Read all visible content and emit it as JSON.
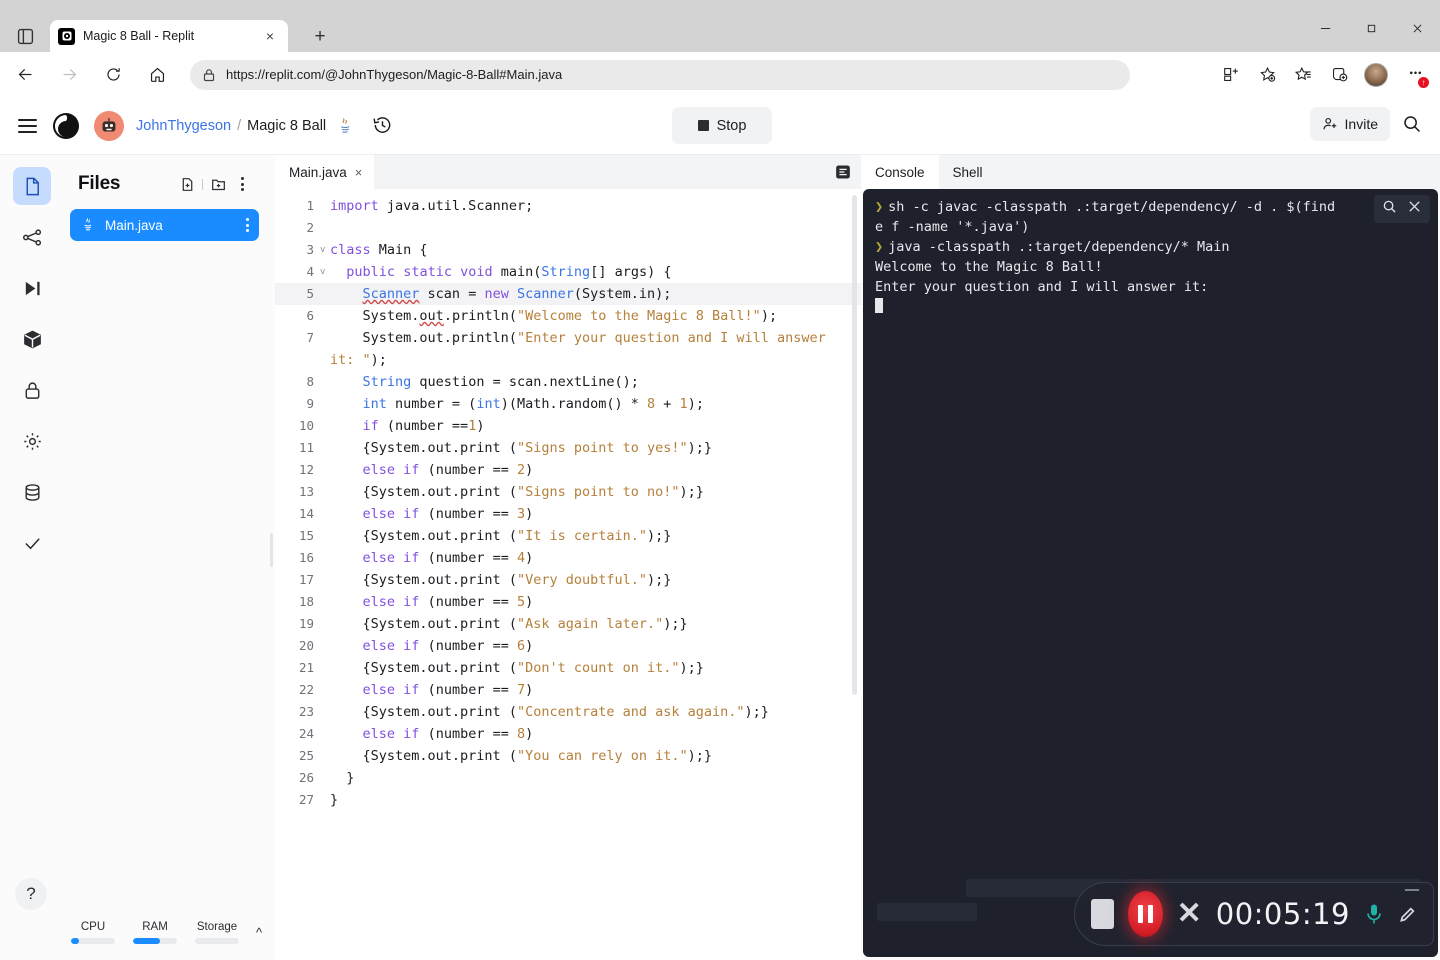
{
  "browser": {
    "tab_strip_icon": "tab-list-icon",
    "tab": {
      "title": "Magic 8 Ball - Replit",
      "favicon": "replit-favicon",
      "close": "×"
    },
    "new_tab_label": "+",
    "window_controls": {
      "minimize": "minimize-icon",
      "maximize": "maximize-icon",
      "close": "close-icon"
    },
    "toolbar": {
      "back": "back-arrow-icon",
      "forward": "forward-arrow-icon",
      "reload": "reload-icon",
      "home": "home-icon",
      "lock": "lock-icon",
      "url_prefix": "https://",
      "url_domain": "replit.com",
      "url_path": "/@JohnThygeson/Magic-8-Ball#Main.java",
      "url_full": "https://replit.com/@JohnThygeson/Magic-8-Ball#Main.java",
      "icons": [
        "split-screen-icon",
        "add-favorite-icon",
        "favorites-icon",
        "collections-icon",
        "profile-avatar-icon",
        "more-options-icon"
      ],
      "badge": "↑"
    }
  },
  "replit": {
    "header": {
      "menu": "hamburger-menu-icon",
      "logo": "replit-logo-icon",
      "avatar": "user-avatar-icon",
      "breadcrumb_user": "JohnThygeson",
      "breadcrumb_separator": "/",
      "breadcrumb_project": "Magic 8 Ball",
      "language_icon": "java-icon",
      "history_icon": "history-icon",
      "run_button_label": "Stop",
      "run_button_icon": "stop-square-icon",
      "invite_label": "Invite",
      "invite_icon": "add-person-icon",
      "search_icon": "search-icon"
    },
    "rail": [
      {
        "name": "files",
        "icon": "file-icon",
        "active": true
      },
      {
        "name": "version-control",
        "icon": "git-branch-icon",
        "active": false
      },
      {
        "name": "run-debug",
        "icon": "play-step-icon",
        "active": false
      },
      {
        "name": "packages",
        "icon": "package-cube-icon",
        "active": false
      },
      {
        "name": "secrets",
        "icon": "lock-icon",
        "active": false
      },
      {
        "name": "settings",
        "icon": "gear-icon",
        "active": false
      },
      {
        "name": "database",
        "icon": "database-icon",
        "active": false
      },
      {
        "name": "checks",
        "icon": "checkmark-icon",
        "active": false
      }
    ],
    "help_label": "?",
    "files": {
      "title": "Files",
      "new_file_icon": "new-file-icon",
      "new_folder_icon": "new-folder-icon",
      "more_icon": "more-vertical-icon",
      "items": [
        {
          "name": "Main.java",
          "icon": "java-icon",
          "selected": true,
          "more_icon": "more-vertical-icon"
        }
      ]
    },
    "resources": [
      {
        "label": "CPU",
        "percent": 8
      },
      {
        "label": "RAM",
        "percent": 62
      },
      {
        "label": "Storage",
        "percent": 0
      }
    ],
    "resources_caret": "^",
    "editor": {
      "tab_label": "Main.java",
      "tab_close": "×",
      "layout_icon": "editor-options-icon",
      "highlighted_line": 5,
      "lines": [
        {
          "n": 1,
          "fold": "",
          "html": "<span class=\"k\">import</span> java.util.Scanner;"
        },
        {
          "n": 2,
          "fold": "",
          "html": ""
        },
        {
          "n": 3,
          "fold": "v",
          "html": "<span class=\"k\">class</span> Main {"
        },
        {
          "n": 4,
          "fold": "v",
          "html": "  <span class=\"k\">public</span> <span class=\"k\">static</span> <span class=\"k\">void</span> main(<span class=\"kb\">String</span>[] args) {"
        },
        {
          "n": 5,
          "fold": "",
          "html": "    <span class=\"kb sq\">Scanner</span> scan = <span class=\"k\">new</span> <span class=\"kb\">Scanner</span>(System.in);"
        },
        {
          "n": 6,
          "fold": "",
          "html": "    System.<span class=\"sq\">out</span>.println(<span class=\"s\">\"Welcome to the Magic 8 Ball!\"</span>);"
        },
        {
          "n": 7,
          "fold": "",
          "html": "    System.out.println(<span class=\"s\">\"Enter your question and I will answer it: \"</span>);"
        },
        {
          "n": 8,
          "fold": "",
          "html": "    <span class=\"kb\">String</span> question = scan.nextLine();"
        },
        {
          "n": 9,
          "fold": "",
          "html": "    <span class=\"kb\">int</span> number = (<span class=\"kb\">int</span>)(Math.random() * <span class=\"n\">8</span> + <span class=\"n\">1</span>);"
        },
        {
          "n": 10,
          "fold": "",
          "html": "    <span class=\"k\">if</span> (number ==<span class=\"n\">1</span>)"
        },
        {
          "n": 11,
          "fold": "",
          "html": "    {System.out.print (<span class=\"s\">\"Signs point to yes!\"</span>);}"
        },
        {
          "n": 12,
          "fold": "",
          "html": "    <span class=\"k\">else</span> <span class=\"k\">if</span> (number == <span class=\"n\">2</span>)"
        },
        {
          "n": 13,
          "fold": "",
          "html": "    {System.out.print (<span class=\"s\">\"Signs point to no!\"</span>);}"
        },
        {
          "n": 14,
          "fold": "",
          "html": "    <span class=\"k\">else</span> <span class=\"k\">if</span> (number == <span class=\"n\">3</span>)"
        },
        {
          "n": 15,
          "fold": "",
          "html": "    {System.out.print (<span class=\"s\">\"It is certain.\"</span>);}"
        },
        {
          "n": 16,
          "fold": "",
          "html": "    <span class=\"k\">else</span> <span class=\"k\">if</span> (number == <span class=\"n\">4</span>)"
        },
        {
          "n": 17,
          "fold": "",
          "html": "    {System.out.print (<span class=\"s\">\"Very doubtful.\"</span>);}"
        },
        {
          "n": 18,
          "fold": "",
          "html": "    <span class=\"k\">else</span> <span class=\"k\">if</span> (number == <span class=\"n\">5</span>)"
        },
        {
          "n": 19,
          "fold": "",
          "html": "    {System.out.print (<span class=\"s\">\"Ask again later.\"</span>);}"
        },
        {
          "n": 20,
          "fold": "",
          "html": "    <span class=\"k\">else</span> <span class=\"k\">if</span> (number == <span class=\"n\">6</span>)"
        },
        {
          "n": 21,
          "fold": "",
          "html": "    {System.out.print (<span class=\"s\">\"Don't count on it.\"</span>);}"
        },
        {
          "n": 22,
          "fold": "",
          "html": "    <span class=\"k\">else</span> <span class=\"k\">if</span> (number == <span class=\"n\">7</span>)"
        },
        {
          "n": 23,
          "fold": "",
          "html": "    {System.out.print (<span class=\"s\">\"Concentrate and ask again.\"</span>);}"
        },
        {
          "n": 24,
          "fold": "",
          "html": "    <span class=\"k\">else</span> <span class=\"k\">if</span> (number == <span class=\"n\">8</span>)"
        },
        {
          "n": 25,
          "fold": "",
          "html": "    {System.out.print (<span class=\"s\">\"You can rely on it.\"</span>);}"
        },
        {
          "n": 26,
          "fold": "",
          "html": "  }"
        },
        {
          "n": 27,
          "fold": "",
          "html": "}"
        }
      ]
    },
    "console": {
      "tabs": [
        {
          "label": "Console",
          "active": true
        },
        {
          "label": "Shell",
          "active": false
        }
      ],
      "search_icon": "search-icon",
      "close_icon": "close-icon",
      "lines": [
        {
          "prompt": true,
          "text": "sh -c javac -classpath .:target/dependency/ -d . $(find"
        },
        {
          "prompt": false,
          "text": "e f -name '*.java')"
        },
        {
          "prompt": true,
          "text": "java -classpath .:target/dependency/* Main"
        },
        {
          "prompt": false,
          "text": "Welcome to the Magic 8 Ball!"
        },
        {
          "prompt": false,
          "text": "Enter your question and I will answer it:"
        }
      ]
    }
  },
  "recorder": {
    "stop_icon": "stop-recording-icon",
    "pause_icon": "pause-recording-icon",
    "cancel_icon": "cancel-recording-icon",
    "timer": "00:05:19",
    "mic_icon": "microphone-icon",
    "pen_icon": "pencil-annotate-icon",
    "minimize_icon": "minimize-icon"
  },
  "colors": {
    "accent_blue": "#1a8cff",
    "link_blue": "#3b74e8",
    "console_bg": "#1e212b",
    "record_red": "#d41d27",
    "mic_teal": "#1fb3a6",
    "keyword_purple": "#8250df",
    "string_gold": "#b5803b"
  }
}
